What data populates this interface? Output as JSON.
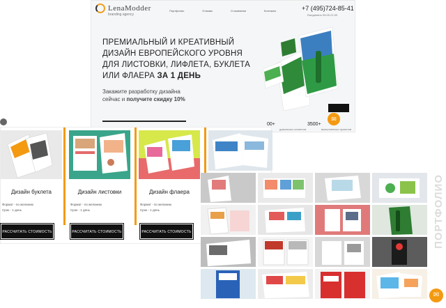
{
  "header": {
    "logo_main": "LenaModder",
    "logo_sub": "branding agency",
    "nav": [
      "Портфолио",
      "Отзывы",
      "О компании",
      "Контакты"
    ],
    "phone": "+7 (495)724-85-41",
    "phone_sub": "Ежедневно 09:00-21:00"
  },
  "hero": {
    "headline_1": "Премиальный и креативный",
    "headline_2": "дизайн европейского уровня",
    "headline_3": "для листовки, лифлета, буклета",
    "headline_4a": "или флаера ",
    "headline_4b": "за 1 день",
    "sub_1": "Закажите разработку дизайна",
    "sub_2a": "сейчас и ",
    "sub_2b": "получите скидку 10%",
    "stat1": "00+",
    "stat1_label": "довольных клиентов",
    "stat2": "3500+",
    "stat2_label": "выполненных проектов"
  },
  "services": [
    {
      "title": "Дизайн буклета",
      "meta_1": "Формат - по желанию",
      "meta_2": "Срок - 1 день",
      "button": "РАССЧИТАТЬ СТОИМОСТЬ"
    },
    {
      "title": "Дизайн листовки",
      "meta_1": "Формат - по желанию",
      "meta_2": "Срок - 1 день",
      "button": "РАССЧИТАТЬ СТОИМОСТЬ"
    },
    {
      "title": "Дизайн флаера",
      "meta_1": "Формат - по желанию",
      "meta_2": "Срок - 1 день",
      "button": "РАССЧИТАТЬ СТОИМОСТЬ"
    }
  ],
  "portfolio": {
    "vertical_label": "ПОРТФОЛИО"
  },
  "colors": {
    "accent": "#f39a12",
    "dark": "#111111"
  },
  "icons": {
    "chat": "chat-icon"
  }
}
